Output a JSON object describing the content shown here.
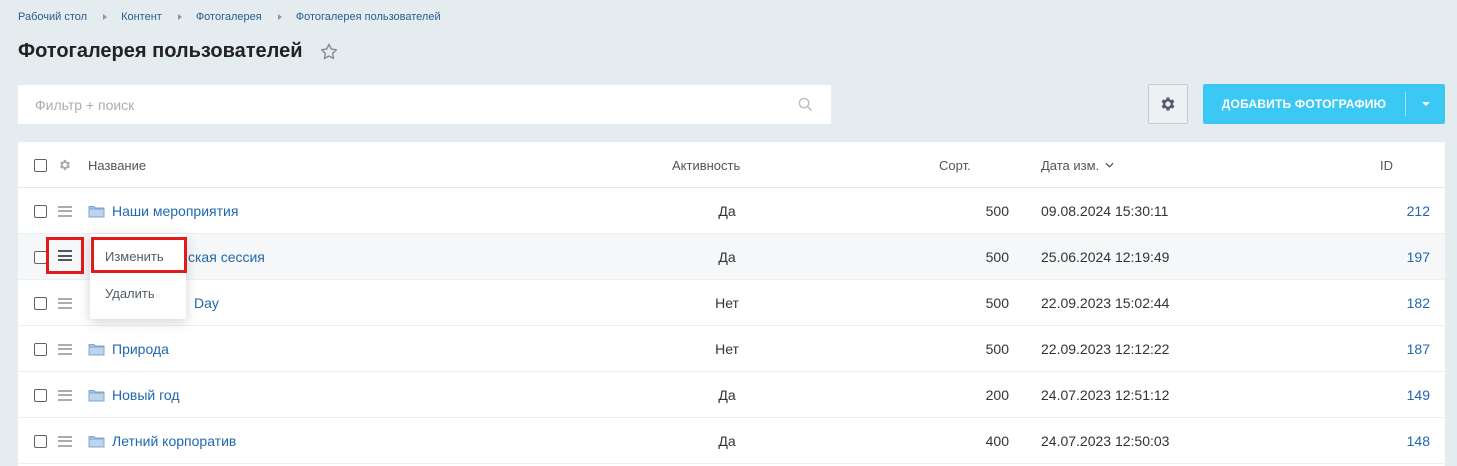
{
  "breadcrumb": [
    "Рабочий стол",
    "Контент",
    "Фотогалерея",
    "Фотогалерея пользователей"
  ],
  "page_title": "Фотогалерея пользователей",
  "filter": {
    "placeholder": "Фильтр + поиск"
  },
  "toolbar": {
    "add_label": "Добавить фотографию"
  },
  "table": {
    "headers": {
      "name": "Название",
      "active": "Активность",
      "sort": "Сорт.",
      "date": "Дата изм.",
      "id": "ID"
    },
    "rows": [
      {
        "name": "Наши мероприятия",
        "active": "Да",
        "sort": "500",
        "date": "09.08.2024 15:30:11",
        "id": "212"
      },
      {
        "name": "ская сессия",
        "active": "Да",
        "sort": "500",
        "date": "25.06.2024 12:19:49",
        "id": "197"
      },
      {
        "name": "Day",
        "active": "Нет",
        "sort": "500",
        "date": "22.09.2023 15:02:44",
        "id": "182"
      },
      {
        "name": "Природа",
        "active": "Нет",
        "sort": "500",
        "date": "22.09.2023 12:12:22",
        "id": "187"
      },
      {
        "name": "Новый год",
        "active": "Да",
        "sort": "200",
        "date": "24.07.2023 12:51:12",
        "id": "149"
      },
      {
        "name": "Летний корпоратив",
        "active": "Да",
        "sort": "400",
        "date": "24.07.2023 12:50:03",
        "id": "148"
      }
    ]
  },
  "context_menu": {
    "edit": "Изменить",
    "delete": "Удалить"
  },
  "colors": {
    "accent": "#3bc8f5",
    "link": "#2067b0",
    "highlight": "#e31a1a"
  }
}
